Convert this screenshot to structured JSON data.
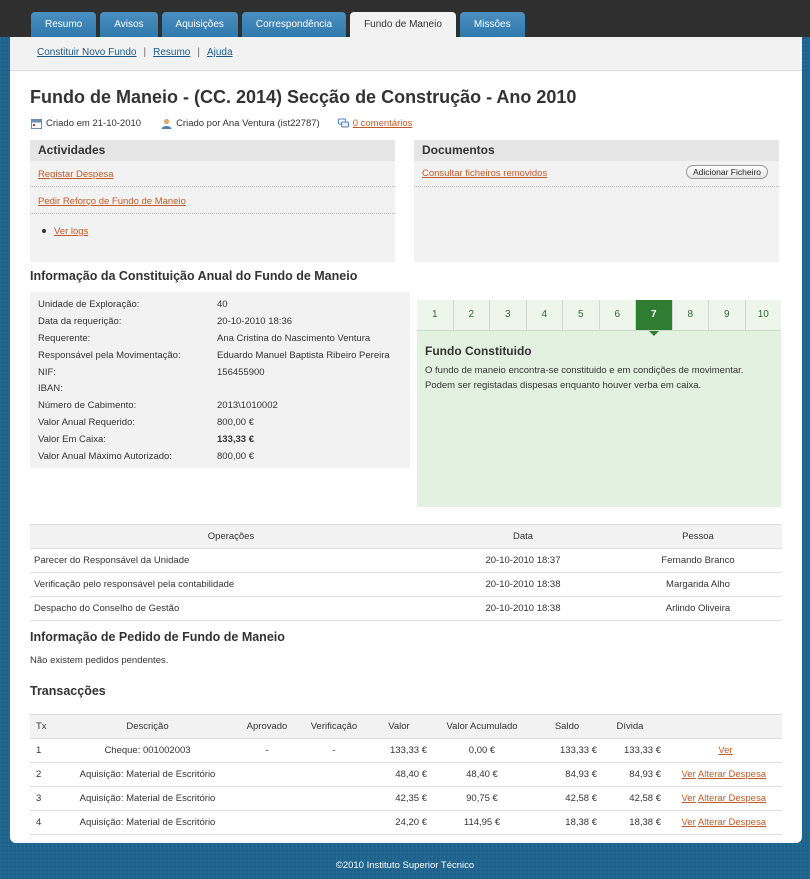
{
  "tabs": [
    {
      "label": "Resumo"
    },
    {
      "label": "Avisos"
    },
    {
      "label": "Aquisições"
    },
    {
      "label": "Correspondência"
    },
    {
      "label": "Fundo de Maneio"
    },
    {
      "label": "Missões"
    }
  ],
  "subnav": {
    "new_fund": "Constituir Novo Fundo",
    "summary": "Resumo",
    "help": "Ajuda"
  },
  "page_title": "Fundo de Maneio - (CC. 2014) Secção de Construção - Ano 2010",
  "meta": {
    "created_on": "Criado em 21-10-2010",
    "created_by": "Criado por Ana Ventura (ist22787)",
    "comments": "0 comentários"
  },
  "activities": {
    "title": "Actividades",
    "register_expense": "Registar Despesa",
    "request_reinforcement": "Pedir Reforço de Fundo de Maneio",
    "view_logs": "Ver logs"
  },
  "documents": {
    "title": "Documentos",
    "removed_files": "Consultar ficheiros removidos",
    "add_file": "Adicionar Ficheiro"
  },
  "constitution": {
    "title": "Informação da Constituição Anual do Fundo de Maneio",
    "rows": [
      {
        "k": "Unidade de Exploração:",
        "v": "40"
      },
      {
        "k": "Data da requerição:",
        "v": "20-10-2010 18:36"
      },
      {
        "k": "Requerente:",
        "v": "Ana Cristina do Nascimento Ventura"
      },
      {
        "k": "Responsável pela Movimentação:",
        "v": "Eduardo Manuel Baptista Ribeiro Pereira"
      },
      {
        "k": "NIF:",
        "v": "156455900"
      },
      {
        "k": "IBAN:",
        "v": ""
      },
      {
        "k": "Número de Cabimento:",
        "v": "2013\\1010002"
      },
      {
        "k": "Valor Anual Requerido:",
        "v": "800,00 €"
      },
      {
        "k": "Valor Em Caixa:",
        "v": "133,33 €"
      },
      {
        "k": "Valor Anual Máximo Autorizado:",
        "v": "800,00 €"
      }
    ]
  },
  "steps": {
    "items": [
      "1",
      "2",
      "3",
      "4",
      "5",
      "6",
      "7",
      "8",
      "9",
      "10"
    ],
    "active": "7",
    "status_title": "Fundo Constituido",
    "status_desc": "O fundo de maneio encontra-se constituido e em condições de movimentar. Podem ser registadas dispesas enquanto houver verba em caixa."
  },
  "operations": {
    "headers": {
      "op": "Operações",
      "date": "Data",
      "person": "Pessoa"
    },
    "rows": [
      {
        "op": "Parecer do Responsável da Unidade",
        "date": "20-10-2010 18:37",
        "person": "Fernando Branco"
      },
      {
        "op": "Verificação pelo responsável pela contabilidade",
        "date": "20-10-2010 18:38",
        "person": "Margarida Alho"
      },
      {
        "op": "Despacho do Conselho de Gestão",
        "date": "20-10-2010 18:38",
        "person": "Arlindo Oliveira"
      }
    ]
  },
  "requests": {
    "title": "Informação de Pedido de Fundo de Maneio",
    "empty": "Não existem pedidos pendentes."
  },
  "transactions": {
    "title": "Transacções",
    "headers": {
      "tx": "Tx",
      "desc": "Descrição",
      "approved": "Aprovado",
      "verification": "Verificação",
      "value": "Valor",
      "accum": "Valor Acumulado",
      "balance": "Saldo",
      "debt": "Dívida"
    },
    "rows": [
      {
        "tx": "1",
        "desc": "Cheque: 001002003",
        "approved": "-",
        "verification": "-",
        "value": "133,33 €",
        "accum": "0,00 €",
        "balance": "133,33 €",
        "debt": "133,33 €",
        "view": "Ver",
        "change": ""
      },
      {
        "tx": "2",
        "desc": "Aquisição: Material de Escritório",
        "approved": "",
        "verification": "",
        "value": "48,40 €",
        "accum": "48,40 €",
        "balance": "84,93 €",
        "debt": "84,93 €",
        "view": "Ver",
        "change": "Alterar Despesa"
      },
      {
        "tx": "3",
        "desc": "Aquisição: Material de Escritório",
        "approved": "",
        "verification": "",
        "value": "42,35 €",
        "accum": "90,75 €",
        "balance": "42,58 €",
        "debt": "42,58 €",
        "view": "Ver",
        "change": "Alterar Despesa"
      },
      {
        "tx": "4",
        "desc": "Aquisição: Material de Escritório",
        "approved": "",
        "verification": "",
        "value": "24,20 €",
        "accum": "114,95 €",
        "balance": "18,38 €",
        "debt": "18,38 €",
        "view": "Ver",
        "change": "Alterar Despesa"
      }
    ]
  },
  "footer": "©2010 Instituto Superior Técnico"
}
